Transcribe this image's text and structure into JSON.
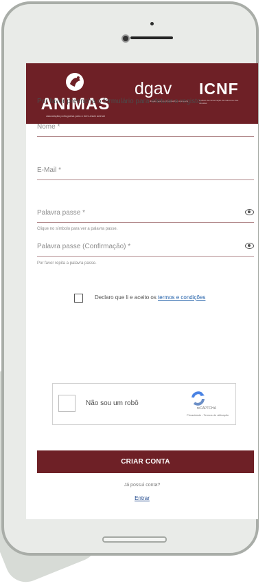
{
  "header": {
    "logos": [
      {
        "name": "ANIMAS",
        "subtitle": "associação portuguesa para o bem-estar animal"
      },
      {
        "name": "dgav",
        "subtitle": "direção-geral de alimentação e veterinária"
      },
      {
        "name": "ICNF",
        "subtitle": "instituto da conservação da natureza e das florestas"
      }
    ]
  },
  "form": {
    "intro": "Por favor preencha o formulário para efetuar o registo.",
    "name_placeholder": "Nome *",
    "email_placeholder": "E-Mail *",
    "password_placeholder": "Palavra passe *",
    "password_hint": "Clique no símbolo para ver a palavra passe.",
    "password_confirm_placeholder": "Palavra passe (Confirmação) *",
    "password_confirm_hint": "Por favor repita a palavra passe.",
    "terms_prefix": "Declaro que li e aceito os ",
    "terms_link": "termos e condições",
    "captcha_label": "Não sou um robô",
    "captcha_brand": "reCAPTCHA",
    "captcha_legal": "Privacidade - Termos de utilização",
    "submit_label": "CRIAR CONTA",
    "account_question": "Já possui conta?",
    "login_label": "Entrar"
  },
  "colors": {
    "brand": "#6e2026",
    "link": "#1f5ea8"
  },
  "icons": {
    "password_visibility": "eye-icon",
    "captcha": "recaptcha-icon"
  }
}
